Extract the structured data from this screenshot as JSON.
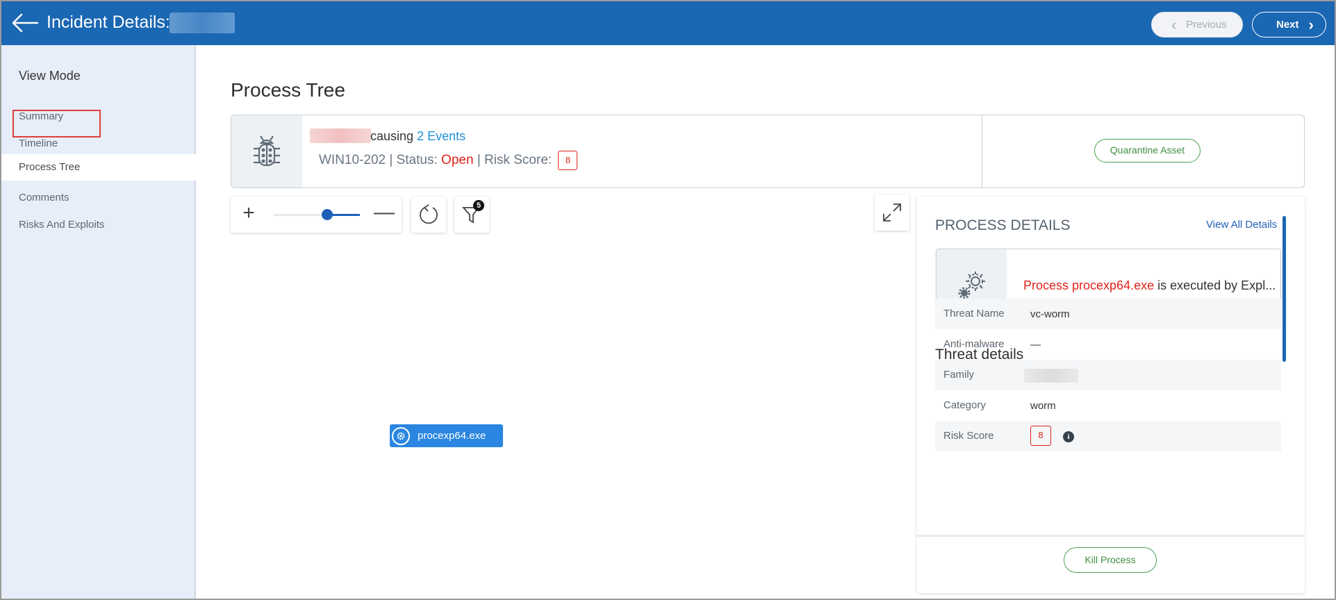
{
  "header": {
    "title": "Incident Details:",
    "previous_label": "Previous",
    "next_label": "Next",
    "accent_color": "#1a67b3"
  },
  "sidebar": {
    "heading": "View Mode",
    "items": [
      {
        "label": "Summary"
      },
      {
        "label": "Timeline"
      },
      {
        "label": "Process Tree",
        "active": true
      },
      {
        "label": "Comments"
      },
      {
        "label": "Risks And Exploits"
      }
    ]
  },
  "main": {
    "title": "Process Tree"
  },
  "incident": {
    "causing_text": "causing",
    "events_link": "2 Events",
    "host": "WIN10-202",
    "sep1": "|",
    "status_label": "Status:",
    "status_value": "Open",
    "sep2": "|",
    "risk_label": "Risk Score:",
    "risk_score": "8",
    "quarantine_label": "Quarantine Asset"
  },
  "toolbar": {
    "zoom_in_symbol": "+",
    "zoom_out_symbol": "—",
    "zoom_level": 0.62,
    "filter_count": "5"
  },
  "tree": {
    "node_label": "procexp64.exe"
  },
  "details": {
    "title": "PROCESS DETAILS",
    "view_all_label": "View All Details",
    "process_prefix": "Process procexp64.exe",
    "process_suffix": " is executed by Expl...",
    "threat_title": "Threat details",
    "rows": [
      {
        "label": "Threat Name",
        "value": "vc-worm"
      },
      {
        "label": "Anti-malware",
        "value": "—"
      },
      {
        "label": "Family",
        "value": ""
      },
      {
        "label": "Category",
        "value": "worm"
      },
      {
        "label": "Risk Score",
        "value": "8"
      }
    ],
    "info_symbol": "i",
    "kill_label": "Kill Process"
  }
}
